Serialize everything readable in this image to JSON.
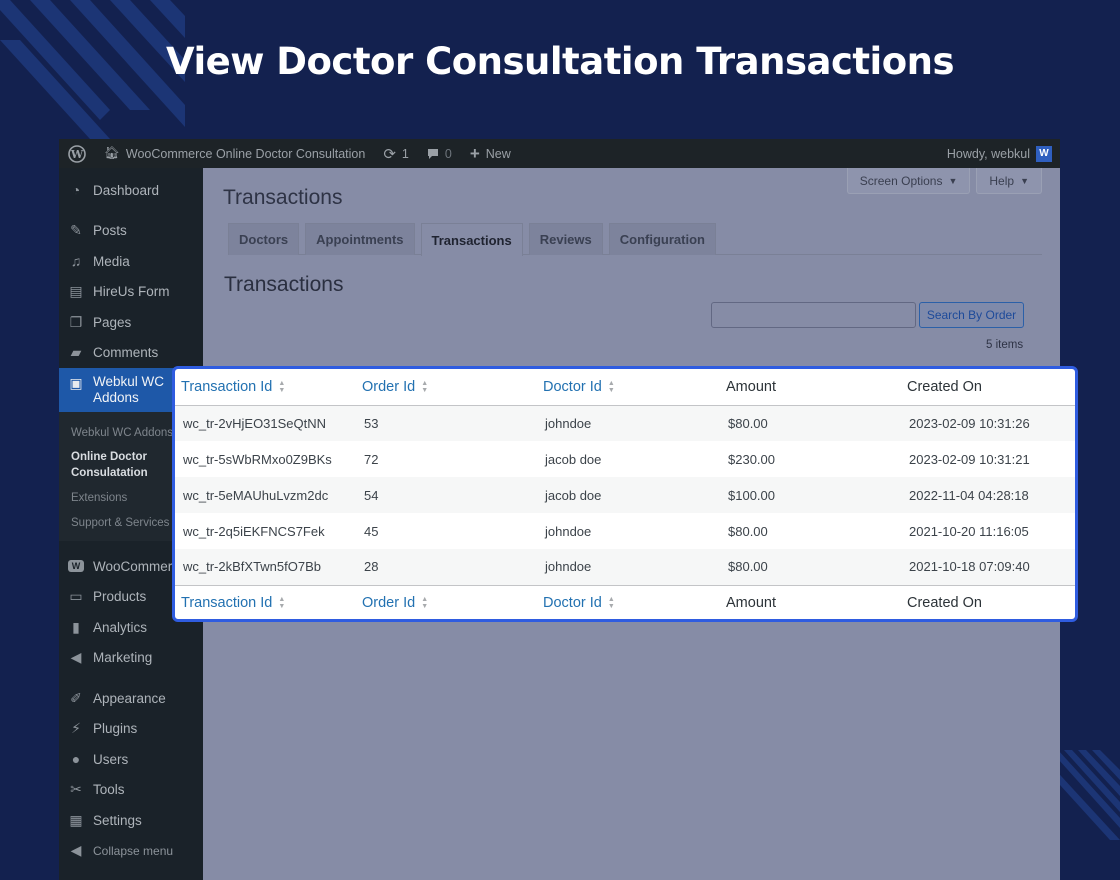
{
  "banner": {
    "title": "View Doctor Consultation Transactions"
  },
  "adminbar": {
    "site_name": "WooCommerce Online Doctor Consultation",
    "updates_count": "1",
    "comments_count": "0",
    "new_label": "New",
    "howdy": "Howdy, webkul",
    "avatar_letter": "W"
  },
  "sidebar": {
    "dashboard": "Dashboard",
    "posts": "Posts",
    "media": "Media",
    "hireus": "HireUs Form",
    "pages": "Pages",
    "comments": "Comments",
    "webkul_addons": "Webkul WC Addons",
    "sub_addons": "Webkul WC Addons",
    "sub_current": "Online Doctor Consulatation",
    "sub_extensions": "Extensions",
    "sub_support": "Support & Services",
    "woocommerce": "WooCommerce",
    "products": "Products",
    "analytics": "Analytics",
    "marketing": "Marketing",
    "appearance": "Appearance",
    "plugins": "Plugins",
    "users": "Users",
    "tools": "Tools",
    "settings": "Settings",
    "collapse": "Collapse menu"
  },
  "top_buttons": {
    "screen_options": "Screen Options",
    "help": "Help"
  },
  "page": {
    "title": "Transactions",
    "section_title": "Transactions",
    "tabs": [
      "Doctors",
      "Appointments",
      "Transactions",
      "Reviews",
      "Configuration"
    ],
    "active_tab": "Transactions",
    "search_placeholder": "",
    "search_button": "Search By Order",
    "items_count": "5 items"
  },
  "table": {
    "columns": [
      "Transaction Id",
      "Order Id",
      "Doctor Id",
      "Amount",
      "Created On"
    ],
    "rows": [
      [
        "wc_tr-2vHjEO31SeQtNN",
        "53",
        "johndoe",
        "$80.00",
        "2023-02-09 10:31:26"
      ],
      [
        "wc_tr-5sWbRMxo0Z9BKs",
        "72",
        "jacob doe",
        "$230.00",
        "2023-02-09 10:31:21"
      ],
      [
        "wc_tr-5eMAUhuLvzm2dc",
        "54",
        "jacob doe",
        "$100.00",
        "2022-11-04 04:28:18"
      ],
      [
        "wc_tr-2q5iEKFNCS7Fek",
        "45",
        "johndoe",
        "$80.00",
        "2021-10-20 11:16:05"
      ],
      [
        "wc_tr-2kBfXTwn5fO7Bb",
        "28",
        "johndoe",
        "$80.00",
        "2021-10-18 07:09:40"
      ]
    ]
  },
  "colors": {
    "background": "#13214f",
    "highlight_border": "#2f5ce0",
    "link": "#2271b1"
  }
}
